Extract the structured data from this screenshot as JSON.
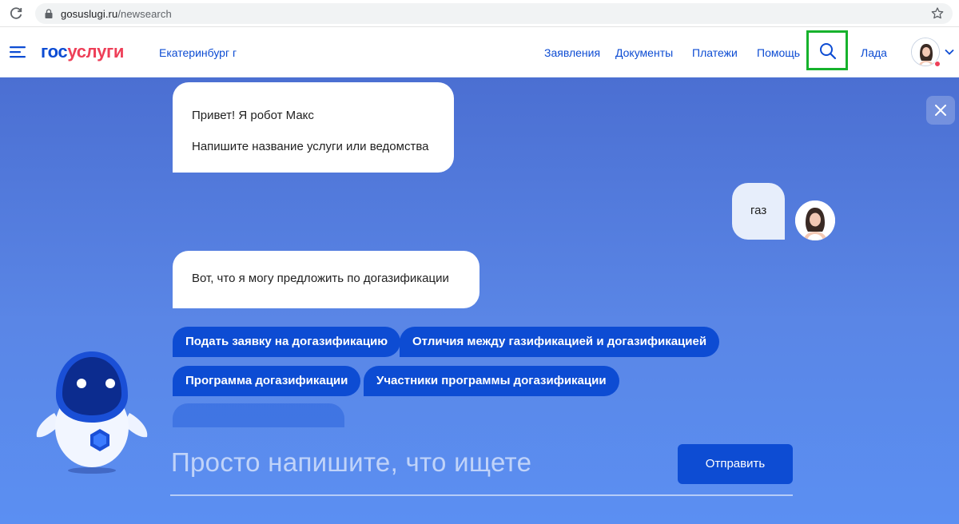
{
  "browser": {
    "url_domain": "gosuslugi.ru",
    "url_path": "/newsearch",
    "reload_icon": "reload-icon",
    "lock_icon": "lock-icon",
    "star_icon": "star-icon"
  },
  "header": {
    "logo_part1": "гос",
    "logo_part2": "услуги",
    "region": "Екатеринбург г",
    "nav": [
      "Заявления",
      "Документы",
      "Платежи",
      "Помощь"
    ],
    "user_name": "Лада",
    "brand_color": "#0d4cd3",
    "logo_accent": "#ee3f58",
    "search_highlight_color": "#16b22c"
  },
  "chat": {
    "bot_message_1": [
      "Привет! Я робот Макс",
      "Напишите название услуги или ведомства"
    ],
    "user_message": "газ",
    "bot_message_2": "Вот, что я могу предложить по догазификации",
    "suggestions": [
      "Подать заявку на догазификацию",
      "Отличия между газификацией и догазификацией",
      "Программа догазификации",
      "Участники программы догазификации"
    ],
    "input_placeholder": "Просто напишите, что ищете",
    "send_label": "Отправить"
  }
}
